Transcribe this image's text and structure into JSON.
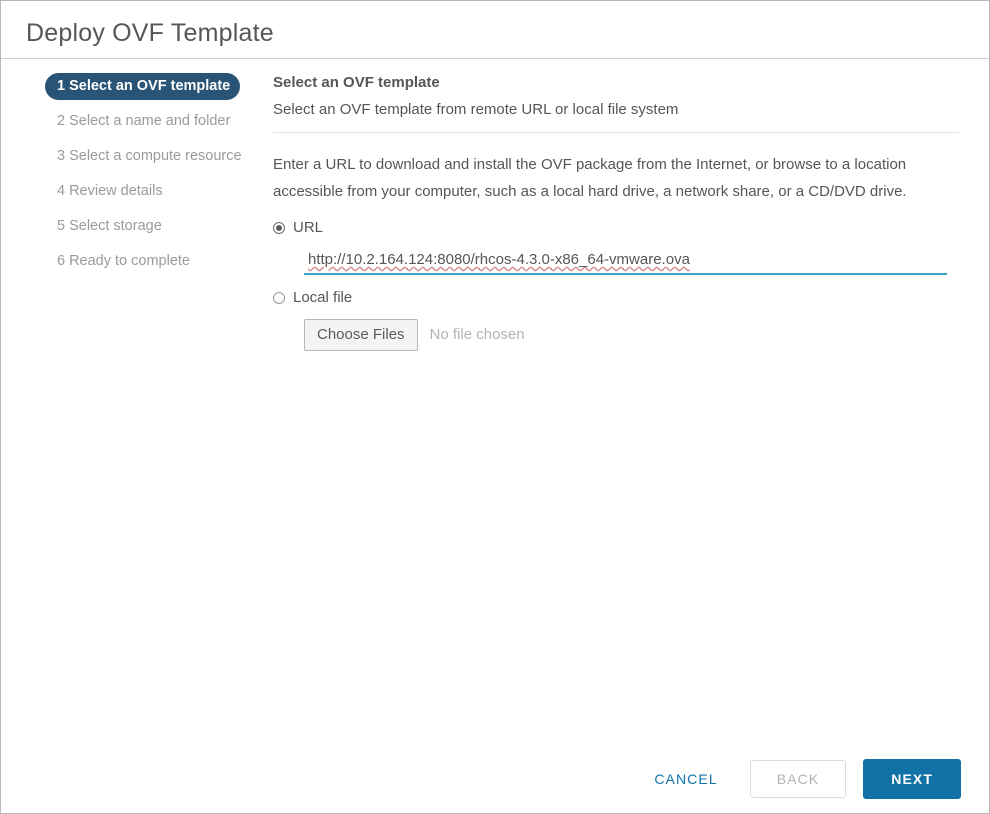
{
  "dialog": {
    "title": "Deploy OVF Template"
  },
  "wizard": {
    "steps": [
      {
        "num": "1",
        "label": "Select an OVF template",
        "active": true
      },
      {
        "num": "2",
        "label": "Select a name and folder",
        "active": false
      },
      {
        "num": "3",
        "label": "Select a compute resource",
        "active": false
      },
      {
        "num": "4",
        "label": "Review details",
        "active": false
      },
      {
        "num": "5",
        "label": "Select storage",
        "active": false
      },
      {
        "num": "6",
        "label": "Ready to complete",
        "active": false
      }
    ]
  },
  "panel": {
    "title": "Select an OVF template",
    "subtitle": "Select an OVF template from remote URL or local file system",
    "description": "Enter a URL to download and install the OVF package from the Internet, or browse to a location accessible from your computer, such as a local hard drive, a network share, or a CD/DVD drive.",
    "source_options": {
      "url": {
        "label": "URL",
        "selected": true,
        "value": "http://10.2.164.124:8080/rhcos-4.3.0-x86_64-vmware.ova"
      },
      "local_file": {
        "label": "Local file",
        "selected": false,
        "choose_button_label": "Choose Files",
        "no_file_text": "No file chosen"
      }
    }
  },
  "footer": {
    "cancel_label": "CANCEL",
    "back_label": "BACK",
    "next_label": "NEXT"
  },
  "colors": {
    "accent_blue": "#1072a6",
    "active_step_navy": "#2a5475",
    "focus_underline": "#3ca3c4",
    "text_grey": "#565656",
    "muted_grey": "#9a9a9a"
  }
}
